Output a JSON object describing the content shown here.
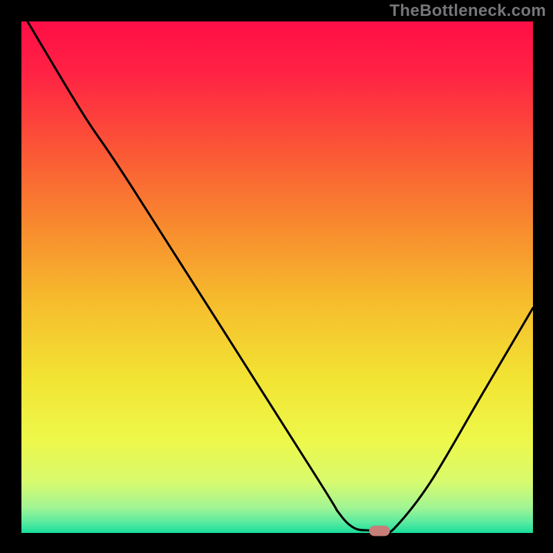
{
  "watermark": "TheBottleneck.com",
  "colors": {
    "black": "#000000",
    "curve": "#000000",
    "marker": "#c77e78",
    "gradient_stops": [
      {
        "offset": 0.0,
        "color": "#ff0e47"
      },
      {
        "offset": 0.1,
        "color": "#ff2244"
      },
      {
        "offset": 0.25,
        "color": "#fb5636"
      },
      {
        "offset": 0.4,
        "color": "#f88a2e"
      },
      {
        "offset": 0.55,
        "color": "#f6bd2d"
      },
      {
        "offset": 0.7,
        "color": "#f2e433"
      },
      {
        "offset": 0.82,
        "color": "#edf84a"
      },
      {
        "offset": 0.9,
        "color": "#d8fa6e"
      },
      {
        "offset": 0.95,
        "color": "#a2f593"
      },
      {
        "offset": 0.98,
        "color": "#58eaa0"
      },
      {
        "offset": 1.0,
        "color": "#17de9c"
      }
    ]
  },
  "chart_data": {
    "type": "line",
    "title": "",
    "xlabel": "",
    "ylabel": "",
    "xlim": [
      0,
      100
    ],
    "ylim": [
      0,
      100
    ],
    "grid": false,
    "legend": false,
    "series": [
      {
        "name": "bottleneck-curve",
        "points": [
          {
            "x": 0,
            "y": 102
          },
          {
            "x": 12,
            "y": 82
          },
          {
            "x": 22,
            "y": 67
          },
          {
            "x": 57,
            "y": 12
          },
          {
            "x": 62,
            "y": 4
          },
          {
            "x": 65,
            "y": 1
          },
          {
            "x": 68,
            "y": 0.5
          },
          {
            "x": 71,
            "y": 0.5
          },
          {
            "x": 73,
            "y": 1
          },
          {
            "x": 80,
            "y": 10
          },
          {
            "x": 90,
            "y": 27
          },
          {
            "x": 100,
            "y": 44
          }
        ]
      }
    ],
    "marker": {
      "x": 70,
      "y": 0.4
    }
  },
  "layout": {
    "canvas": 800,
    "margin": 31,
    "inner": 740
  }
}
